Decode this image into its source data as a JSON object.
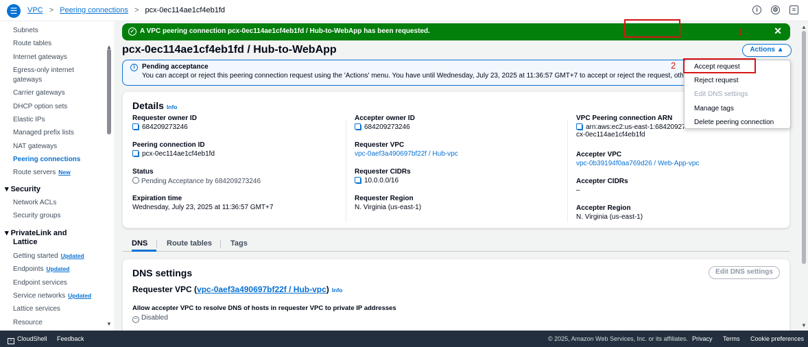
{
  "topbar": {
    "breadcrumbs": [
      "VPC",
      "Peering connections",
      "pcx-0ec114ae1cf4eb1fd"
    ],
    "icons": [
      "menu-icon",
      "info-circle-icon",
      "settings-icon",
      "feedback-icon"
    ]
  },
  "sidebar": {
    "items_top": [
      "Subnets",
      "Route tables",
      "Internet gateways",
      "Egress-only internet",
      "gateways",
      "Carrier gateways",
      "DHCP option sets",
      "Elastic IPs",
      "Managed prefix lists",
      "NAT gateways",
      "Peering connections",
      "Route servers"
    ],
    "new_badge": "New",
    "security_header": "Security",
    "security_items": [
      "Network ACLs",
      "Security groups"
    ],
    "privatelink_header_1": "PrivateLink and",
    "privatelink_header_2": "Lattice",
    "privatelink_items": [
      "Getting started",
      "Endpoints",
      "Endpoint services",
      "Service networks",
      "Lattice services",
      "Resource"
    ],
    "updated_badge": "Updated"
  },
  "flash": {
    "prefix": "A VPC peering connection ",
    "name": "pcx-0ec114ae1cf4eb1fd / Hub-to-WebApp",
    "suffix": " has been requested."
  },
  "page": {
    "title": "pcx-0ec114ae1cf4eb1fd / Hub-to-WebApp",
    "actions_label": "Actions"
  },
  "alert": {
    "title": "Pending acceptance",
    "text": "You can accept or reject this peering connection request using the 'Actions' menu. You have until Wednesday, July 23, 2025 at 11:36:57 GMT+7 to accept or reject the request, otherw"
  },
  "details": {
    "title": "Details",
    "info": "Info",
    "requester_owner_label": "Requester owner ID",
    "requester_owner": "684209273246",
    "peering_id_label": "Peering connection ID",
    "peering_id": "pcx-0ec114ae1cf4eb1fd",
    "status_label": "Status",
    "status": "Pending Acceptance by 684209273246",
    "expiration_label": "Expiration time",
    "expiration": "Wednesday, July 23, 2025 at 11:36:57 GMT+7",
    "accepter_owner_label": "Accepter owner ID",
    "accepter_owner": "684209273246",
    "requester_vpc_label": "Requester VPC",
    "requester_vpc": "vpc-0aef3a490697bf22f / Hub-vpc",
    "requester_cidrs_label": "Requester CIDRs",
    "requester_cidrs": "10.0.0.0/16",
    "requester_region_label": "Requester Region",
    "requester_region": "N. Virginia (us-east-1)",
    "arn_label": "VPC Peering connection ARN",
    "arn_line1": "arn:aws:ec2:us-east-1:68420927...",
    "arn_line2": "cx-0ec114ae1cf4eb1fd",
    "accepter_vpc_label": "Accepter VPC",
    "accepter_vpc": "vpc-0b39194f0aa769d26 / Web-App-vpc",
    "accepter_cidrs_label": "Accepter CIDRs",
    "accepter_cidrs": "–",
    "accepter_region_label": "Accepter Region",
    "accepter_region": "N. Virginia (us-east-1)"
  },
  "tabs": [
    "DNS",
    "Route tables",
    "Tags"
  ],
  "dns": {
    "title": "DNS settings",
    "edit_label": "Edit DNS settings",
    "requester_prefix": "Requester VPC (",
    "requester_link": "vpc-0aef3a490697bf22f / Hub-vpc",
    "requester_suffix": ")",
    "info": "Info",
    "allow_label": "Allow accepter VPC to resolve DNS of hosts in requester VPC to private IP addresses",
    "allow_value": "Disabled"
  },
  "dropdown": {
    "items": [
      "Accept request",
      "Reject request",
      "Edit DNS settings",
      "Manage tags",
      "Delete peering connection"
    ]
  },
  "annotations": [
    "1",
    "2"
  ],
  "footer": {
    "cloudshell": "CloudShell",
    "feedback": "Feedback",
    "copyright": "© 2025, Amazon Web Services, Inc. or its affiliates.",
    "privacy": "Privacy",
    "terms": "Terms",
    "cookies": "Cookie preferences"
  },
  "colors": {
    "accent": "#0972d3",
    "success": "#037f0c",
    "highlight": "#d91515",
    "footer_bg": "#232f3e"
  }
}
